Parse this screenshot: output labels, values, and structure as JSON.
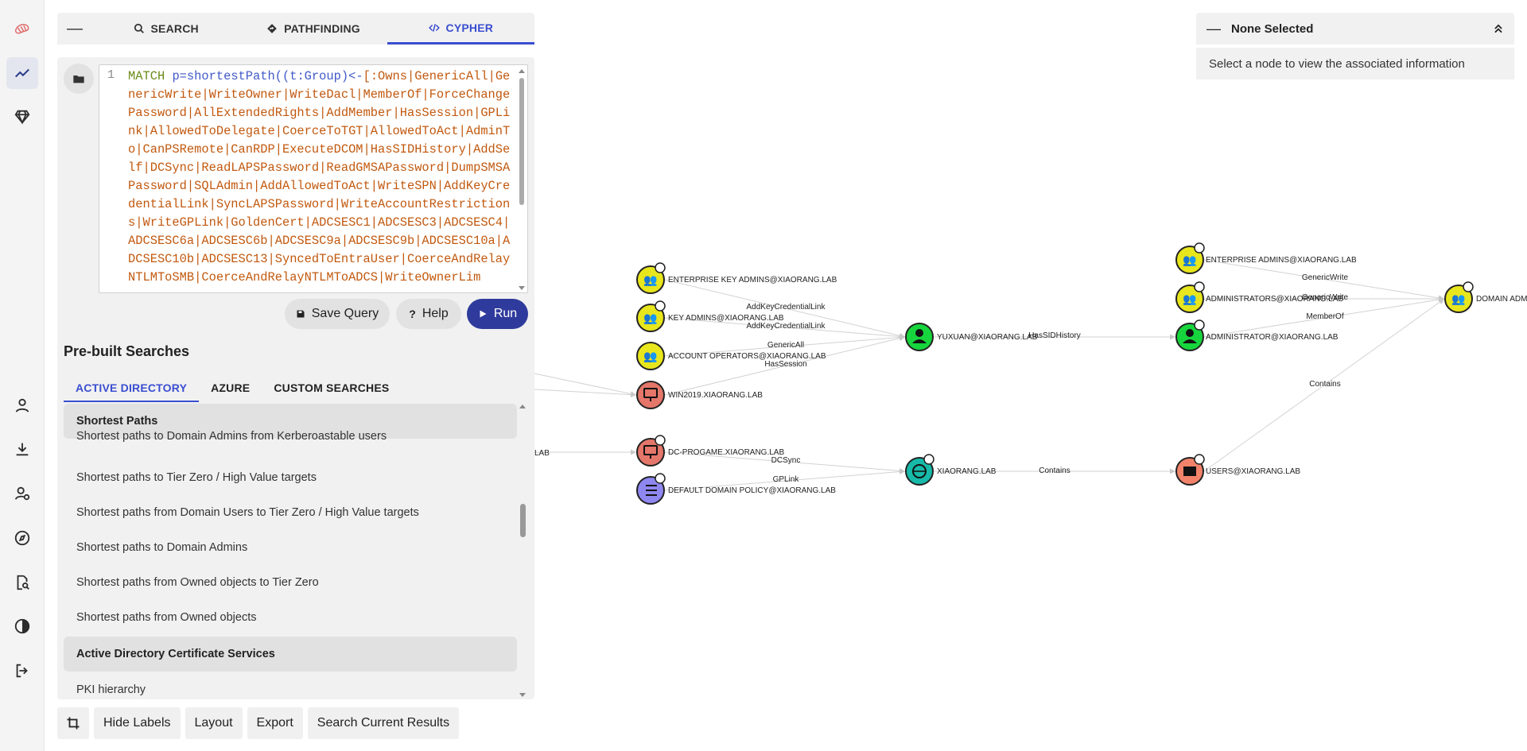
{
  "tabs": {
    "minimize": "—",
    "search": "SEARCH",
    "pathfinding": "PATHFINDING",
    "cypher": "CYPHER"
  },
  "editor": {
    "line_number": "1",
    "query_kw": "MATCH",
    "query_var": "p=shortestPath((t:Group)<-",
    "query_body": "[:Owns|GenericAll|GenericWrite|WriteOwner|WriteDacl|MemberOf|ForceChangePassword|AllExtendedRights|AddMember|HasSession|GPLink|AllowedToDelegate|CoerceToTGT|AllowedToAct|AdminTo|CanPSRemote|CanRDP|ExecuteDCOM|HasSIDHistory|AddSelf|DCSync|ReadLAPSPassword|ReadGMSAPassword|DumpSMSAPassword|SQLAdmin|AddAllowedToAct|WriteSPN|AddKeyCredentialLink|SyncLAPSPassword|WriteAccountRestrictions|WriteGPLink|GoldenCert|ADCSESC1|ADCSESC3|ADCSESC4|ADCSESC6a|ADCSESC6b|ADCSESC9a|ADCSESC9b|ADCSESC10a|ADCSESC10b|ADCSESC13|SyncedToEntraUser|CoerceAndRelayNTLMToSMB|CoerceAndRelayNTLMToADCS|WriteOwnerLim"
  },
  "buttons": {
    "save": "Save Query",
    "help": "Help",
    "run": "Run"
  },
  "prebuilt": {
    "title": "Pre-built Searches",
    "tabs": [
      "ACTIVE DIRECTORY",
      "AZURE",
      "CUSTOM SEARCHES"
    ],
    "items": [
      {
        "label": "Shortest Paths",
        "header": true
      },
      {
        "label": "Shortest paths to Domain Admins from Kerberoastable users",
        "header": false
      },
      {
        "label": "Shortest paths to Tier Zero / High Value targets",
        "header": false
      },
      {
        "label": "Shortest paths from Domain Users to Tier Zero / High Value targets",
        "header": false
      },
      {
        "label": "Shortest paths to Domain Admins",
        "header": false
      },
      {
        "label": "Shortest paths from Owned objects to Tier Zero",
        "header": false
      },
      {
        "label": "Shortest paths from Owned objects",
        "header": false
      },
      {
        "label": "Active Directory Certificate Services",
        "header": true
      },
      {
        "label": "PKI hierarchy",
        "header": false
      }
    ]
  },
  "bottom_bar": {
    "hide_labels": "Hide Labels",
    "layout": "Layout",
    "export": "Export",
    "search_results": "Search Current Results"
  },
  "info": {
    "title": "None Selected",
    "body": "Select a node to view the associated information"
  },
  "graph": {
    "nodes": [
      {
        "label": "ENTERPRISE KEY ADMINS@XIAORANG.LAB",
        "type": "group"
      },
      {
        "label": "KEY ADMINS@XIAORANG.LAB",
        "type": "group"
      },
      {
        "label": "ACCOUNT OPERATORS@XIAORANG.LAB",
        "type": "group"
      },
      {
        "label": "WIN2019.XIAORANG.LAB",
        "type": "computer"
      },
      {
        "label": "DC-PROGAME.XIAORANG.LAB",
        "type": "computer"
      },
      {
        "label": "DEFAULT DOMAIN POLICY@XIAORANG.LAB",
        "type": "gpo"
      },
      {
        "label": "YUXUAN@XIAORANG.LAB",
        "type": "user"
      },
      {
        "label": "XIAORANG.LAB",
        "type": "domain"
      },
      {
        "label": "ENTERPRISE ADMINS@XIAORANG.LAB",
        "type": "group"
      },
      {
        "label": "ADMINISTRATORS@XIAORANG.LAB",
        "type": "group"
      },
      {
        "label": "ADMINISTRATOR@XIAORANG.LAB",
        "type": "user"
      },
      {
        "label": "USERS@XIAORANG.LAB",
        "type": "container"
      },
      {
        "label": "DOMAIN ADM",
        "type": "group"
      },
      {
        "label": "LAB",
        "type": "clipped"
      }
    ],
    "edges": [
      "AddKeyCredentialLink",
      "AddKeyCredentialLink",
      "GenericAll",
      "HasSession",
      "HasSIDHistory",
      "GenericWrite",
      "GenericWrite",
      "MemberOf",
      "Contains",
      "DCSync",
      "GPLink",
      "Contains"
    ]
  },
  "colors": {
    "accent": "#3a4ed0",
    "run": "#2f3b9c",
    "group": "#e8e61c",
    "computer": "#e4766a",
    "user": "#17d63d",
    "domain": "#17b9a8",
    "gpo": "#8f87f0",
    "container": "#f2836b"
  }
}
